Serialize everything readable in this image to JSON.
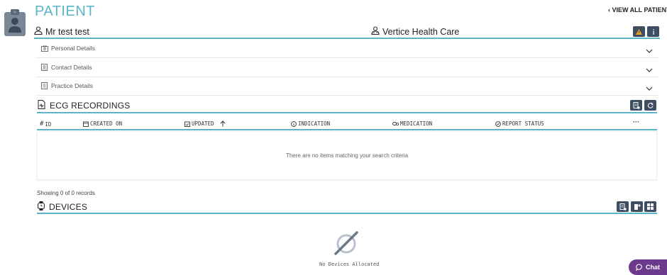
{
  "header": {
    "title": "PATIENT",
    "view_all": "VIEW ALL PATIENTS",
    "patient_name": "Mr test test",
    "practice_name": "Vertice Health Care"
  },
  "accordion": [
    {
      "label": "Personal Details",
      "icon": "id-card-icon"
    },
    {
      "label": "Contact Details",
      "icon": "contact-book-icon"
    },
    {
      "label": "Practice Details",
      "icon": "building-icon"
    }
  ],
  "ecg": {
    "title": "ECG RECORDINGS",
    "columns": [
      "ID",
      "CREATED ON",
      "UPDATED",
      "INDICATION",
      "MEDICATION",
      "REPORT STATUS"
    ],
    "more": "···",
    "empty_message": "There are no items matching your search criteria",
    "records_count": "Showing 0 of 0 records"
  },
  "devices": {
    "title": "DEVICES",
    "empty_message": "No Devices Allocated"
  },
  "chat": {
    "label": "Chat"
  },
  "colors": {
    "accent": "#5ab5c8",
    "button": "#3d4e62",
    "chat": "#6b3a8c",
    "warning": "#f0a020"
  }
}
